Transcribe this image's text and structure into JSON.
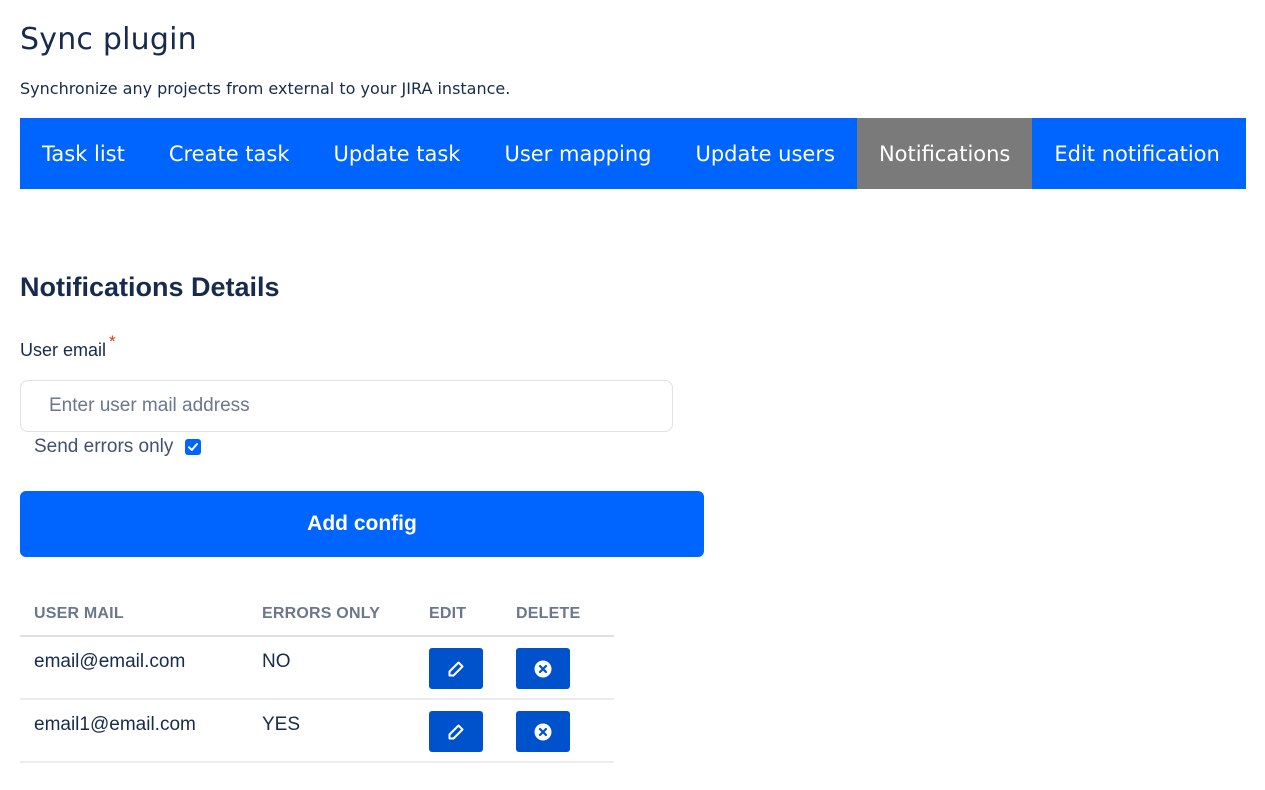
{
  "header": {
    "title": "Sync plugin",
    "subtitle": "Synchronize any projects from external to your JIRA instance."
  },
  "nav": {
    "tabs": [
      {
        "label": "Task list",
        "active": false
      },
      {
        "label": "Create task",
        "active": false
      },
      {
        "label": "Update task",
        "active": false
      },
      {
        "label": "User mapping",
        "active": false
      },
      {
        "label": "Update users",
        "active": false
      },
      {
        "label": "Notifications",
        "active": true
      },
      {
        "label": "Edit notification",
        "active": false
      }
    ]
  },
  "form": {
    "section_title": "Notifications Details",
    "email_label": "User email",
    "required_mark": "*",
    "email_placeholder": "Enter user mail address",
    "email_value": "",
    "send_errors_label": "Send errors only",
    "send_errors_checked": true,
    "add_button_label": "Add config"
  },
  "table": {
    "headers": {
      "mail": "USER MAIL",
      "errors": "ERRORS ONLY",
      "edit": "EDIT",
      "delete": "DELETE"
    },
    "rows": [
      {
        "mail": "email@email.com",
        "errors_only": "NO"
      },
      {
        "mail": "email1@email.com",
        "errors_only": "YES"
      }
    ],
    "edit_icon": "pencil-icon",
    "delete_icon": "close-circle-icon"
  },
  "colors": {
    "primary": "#0065ff",
    "active_tab": "#7a7a7a",
    "icon_button": "#0052cc",
    "required": "#de350b"
  }
}
